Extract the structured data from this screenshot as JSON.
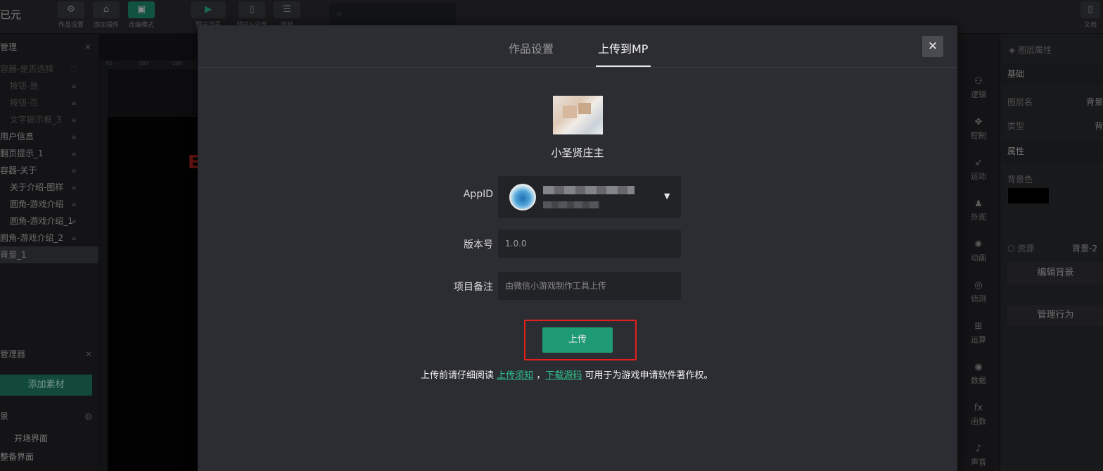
{
  "app": {
    "brand": "已元"
  },
  "toolbar": {
    "items": [
      {
        "label": "作品设置",
        "icon": "⚙"
      },
      {
        "label": "添加插件",
        "icon": "⌂"
      },
      {
        "label": "改编模式",
        "icon": "▣"
      },
      {
        "label": "预览场景",
        "icon": "▶"
      },
      {
        "label": "预览&分享",
        "icon": "▯"
      },
      {
        "label": "面板",
        "icon": "☰"
      }
    ],
    "search_icon": "⌕",
    "doc_label": "文档"
  },
  "layers": {
    "title": "管理",
    "items": [
      {
        "label": "容器-是否选择",
        "state": "dim"
      },
      {
        "label": "按钮-是",
        "state": "dim"
      },
      {
        "label": "按钮-否",
        "state": "dim"
      },
      {
        "label": "文字提示框_3",
        "state": "dim"
      },
      {
        "label": "用户信息",
        "state": "normal"
      },
      {
        "label": "翻页提示_1",
        "state": "normal"
      },
      {
        "label": "容器-关于",
        "state": "normal"
      },
      {
        "label": "关于介绍-图样",
        "state": "normal"
      },
      {
        "label": "圆角-游戏介绍",
        "state": "normal"
      },
      {
        "label": "圆角-游戏介绍_1",
        "state": "normal"
      },
      {
        "label": "圆角-游戏介绍_2",
        "state": "normal"
      },
      {
        "label": "背景_1",
        "state": "selected"
      }
    ]
  },
  "assets": {
    "title": "管理器",
    "add_button": "添加素材"
  },
  "scenes": {
    "title": "景",
    "items": [
      "开场界面",
      "整备界面"
    ]
  },
  "ruler": {
    "ticks": [
      "00",
      "-300",
      "-200"
    ]
  },
  "right_strip": {
    "items": [
      {
        "label": "逻辑",
        "icon": "⚇"
      },
      {
        "label": "控制",
        "icon": "✥"
      },
      {
        "label": "运动",
        "icon": "➶"
      },
      {
        "label": "外观",
        "icon": "♟"
      },
      {
        "label": "动画",
        "icon": "✺"
      },
      {
        "label": "侦测",
        "icon": "◎"
      },
      {
        "label": "运算",
        "icon": "⊞"
      },
      {
        "label": "数据",
        "icon": "◉"
      },
      {
        "label": "函数",
        "icon": "fx"
      },
      {
        "label": "声音",
        "icon": "♪"
      }
    ]
  },
  "properties": {
    "title": "图层属性",
    "section_basic": "基础",
    "layer_name_label": "图层名",
    "layer_name_value": "背景",
    "type_label": "类型",
    "type_value": "背",
    "section_props": "属性",
    "bg_color_label": "背景色",
    "bg_color": "#000000",
    "resource_label": "资源",
    "resource_value": "背景-2",
    "edit_bg_button": "编辑背景",
    "manage_behavior_button": "管理行为"
  },
  "modal": {
    "tabs": [
      {
        "label": "作品设置",
        "active": false
      },
      {
        "label": "上传到MP",
        "active": true
      }
    ],
    "close_icon": "✕",
    "nickname": "小圣贤庄主",
    "appid_label": "AppID",
    "version_label": "版本号",
    "version_value": "1.0.0",
    "remark_label": "项目备注",
    "remark_placeholder": "由微信小游戏制作工具上传",
    "upload_button": "上传",
    "notice_prefix": "上传前请仔细阅读",
    "notice_link1": "上传须知",
    "notice_sep": "，",
    "notice_link2": "下载源码",
    "notice_suffix": "可用于为游戏申请软件著作权。",
    "caret_icon": "▼"
  },
  "colors": {
    "accent": "#1e9a74",
    "highlight": "#e3201b",
    "link": "#2dc58e"
  }
}
